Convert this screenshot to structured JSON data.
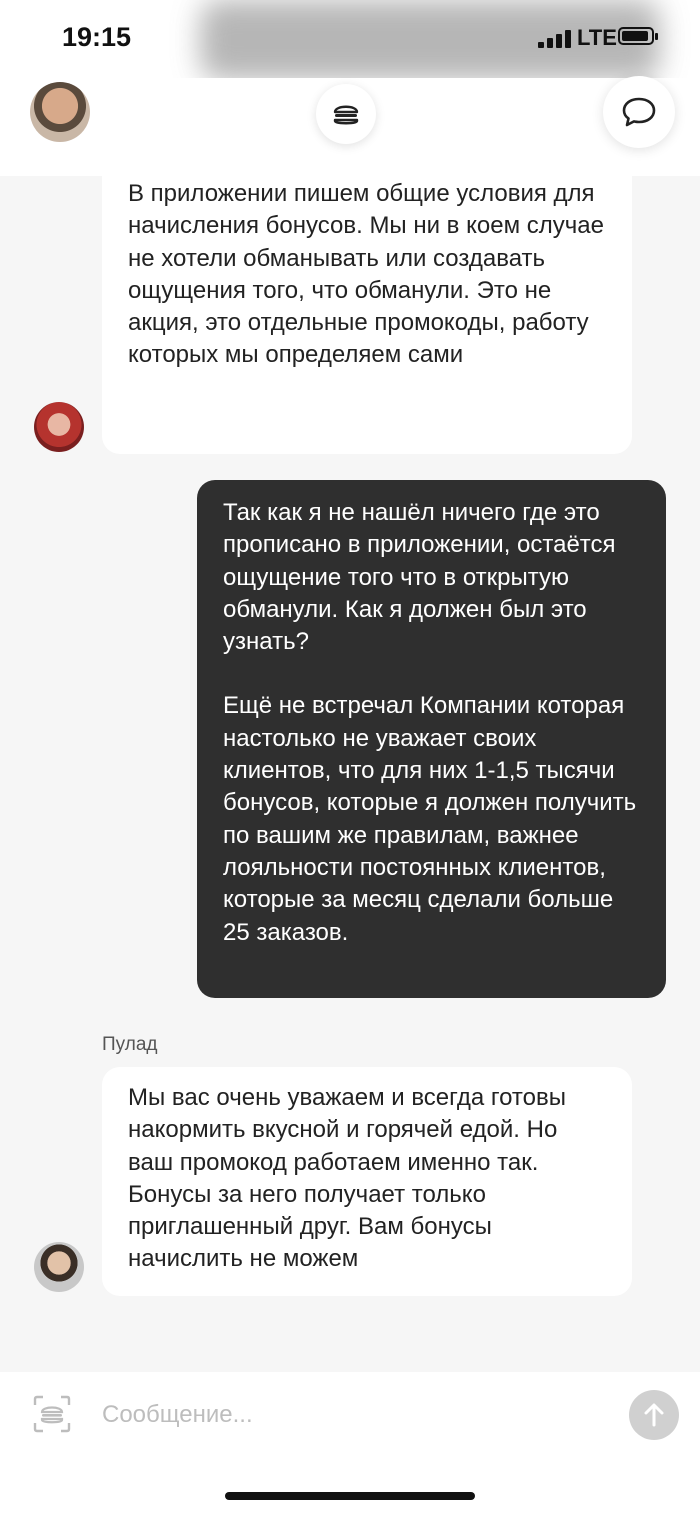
{
  "status_bar": {
    "time": "19:15",
    "network": "LTE"
  },
  "header": {
    "menu_icon": "burger-icon",
    "chat_icon": "speech-bubble-icon"
  },
  "messages": [
    {
      "direction": "incoming",
      "paragraphs": [
        "В приложении пишем общие условия для начисления бонусов. Мы ни в коем случае не хотели обманывать или создавать ощущения того, что обманули. Это не акция, это отдельные промокоды, работу которых мы определяем сами"
      ]
    },
    {
      "direction": "outgoing",
      "paragraphs": [
        "Так как я не нашёл ничего где это прописано в приложении, остаётся ощущение того что в открытую обманули. Как я должен был это узнать?",
        "Ещё не встречал Компании которая настолько не уважает своих клиентов, что для них 1-1,5 тысячи бонусов, которые я должен получить по вашим же правилам, важнее лояльности постоянных клиентов, которые за месяц сделали больше 25 заказов."
      ]
    },
    {
      "direction": "incoming",
      "sender": "Пулад",
      "paragraphs": [
        "Мы вас очень уважаем и всегда готовы накормить вкусной и горячей едой. Но ваш промокод работаем именно так. Бонусы за него получает только приглашенный друг. Вам бонусы начислить не можем"
      ]
    }
  ],
  "composer": {
    "placeholder": "Сообщение...",
    "scan_icon": "burger-scan-icon",
    "send_icon": "arrow-up-icon"
  }
}
